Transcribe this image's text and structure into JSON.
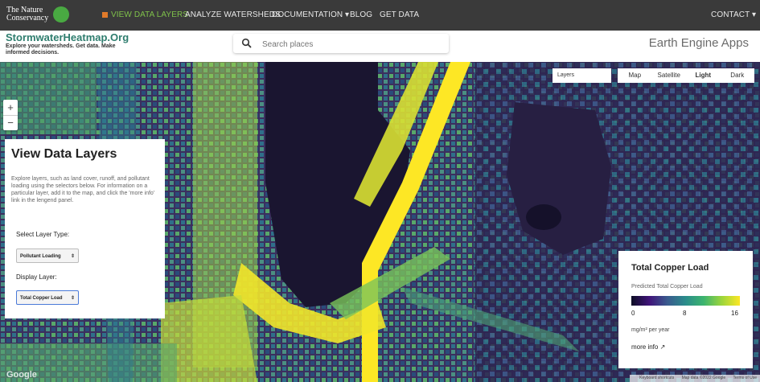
{
  "header": {
    "logo_text": "The Nature Conservancy",
    "nav": [
      {
        "label": "VIEW DATA LAYERS",
        "active": true
      },
      {
        "label": "ANALYZE WATERSHEDS"
      },
      {
        "label": "DOCUMENTATION ▾"
      },
      {
        "label": "BLOG"
      },
      {
        "label": "GET DATA"
      }
    ],
    "contact": "CONTACT ▾"
  },
  "subheader": {
    "brand": "StormwaterHeatmap.Org",
    "tagline": "Explore your watersheds. Get data. Make informed decisions.",
    "search_placeholder": "Search places",
    "earth_engine": "Earth Engine Apps"
  },
  "map": {
    "zoom_in": "+",
    "zoom_out": "−",
    "layers_label": "Layers",
    "map_types": [
      "Map",
      "Satellite",
      "Light",
      "Dark"
    ],
    "selected_map_type": "Light",
    "google_logo": "Google",
    "attribution": [
      "Keyboard shortcuts",
      "Map data ©2022 Google",
      "Terms of Use"
    ]
  },
  "panel": {
    "title": "View Data Layers",
    "description": "Explore layers, such as land cover, runoff, and pollutant loading using the selectors below. For information on a particular layer, add it to the map, and click the 'more info' link in the lengend panel.",
    "layer_type_label": "Select Layer Type:",
    "layer_type_value": "Pollutant Loading",
    "display_layer_label": "Display Layer:",
    "display_layer_value": "Total Copper Load"
  },
  "legend": {
    "title": "Total Copper Load",
    "subtitle": "Predicted Total Copper Load",
    "ticks": [
      "0",
      "8",
      "16"
    ],
    "unit": "mg/m² per year",
    "more_info": "more info ↗",
    "gradient": [
      "#0d0d25",
      "#40147a",
      "#3a5b8e",
      "#2b8c8b",
      "#3cb46e",
      "#9cd53b",
      "#fde725"
    ]
  }
}
